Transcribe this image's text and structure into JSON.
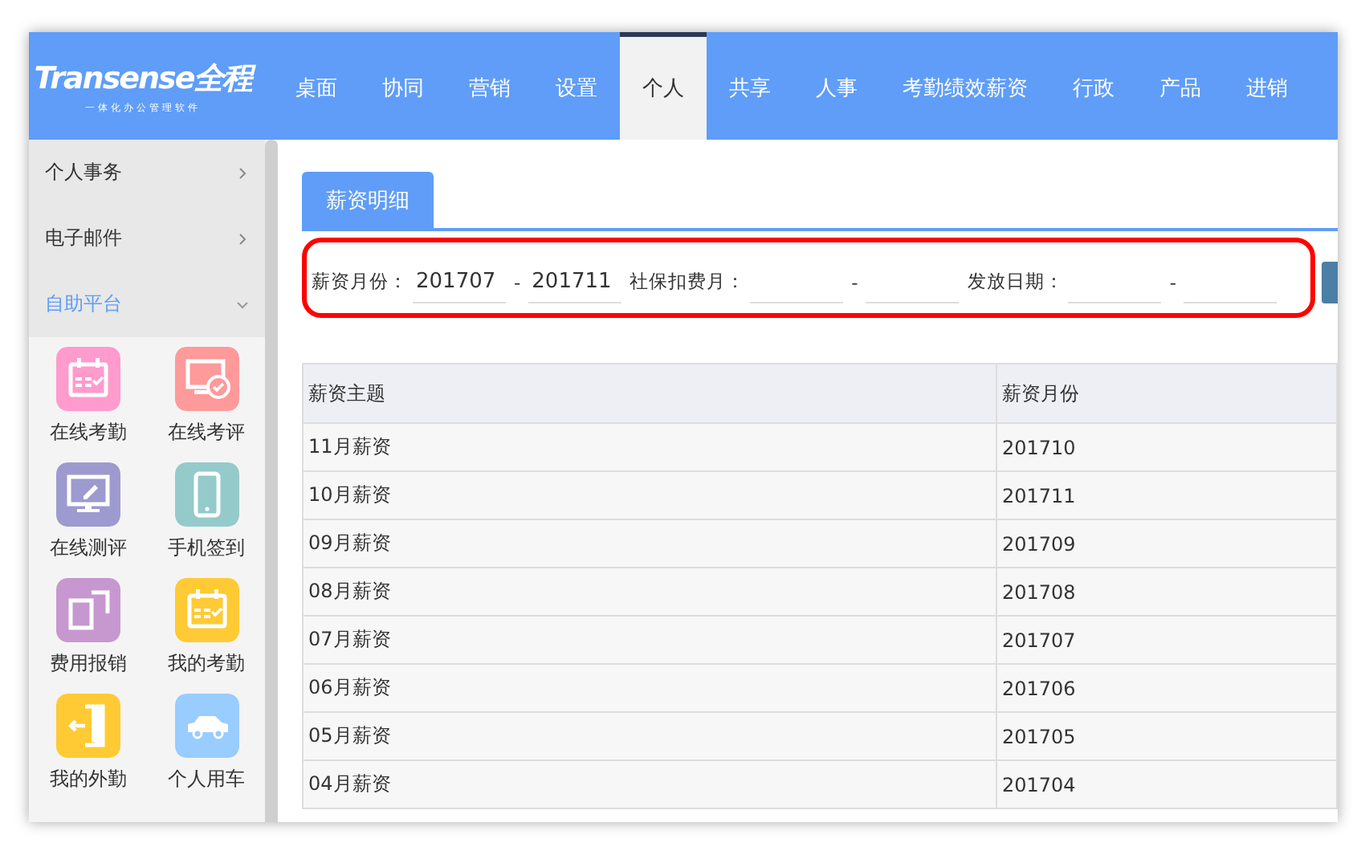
{
  "header": {
    "logo": {
      "brand": "Transense",
      "brand_cn": "全程",
      "tagline": "一体化办公管理软件"
    },
    "nav": [
      {
        "label": "桌面",
        "selected": false
      },
      {
        "label": "协同",
        "selected": false
      },
      {
        "label": "营销",
        "selected": false
      },
      {
        "label": "设置",
        "selected": false
      },
      {
        "label": "个人",
        "selected": true
      },
      {
        "label": "共享",
        "selected": false
      },
      {
        "label": "人事",
        "selected": false
      },
      {
        "label": "考勤绩效薪资",
        "selected": false
      },
      {
        "label": "行政",
        "selected": false
      },
      {
        "label": "产品",
        "selected": false
      },
      {
        "label": "进销",
        "selected": false
      }
    ]
  },
  "sidebar": {
    "items": [
      {
        "label": "个人事务",
        "expanded": false
      },
      {
        "label": "电子邮件",
        "expanded": false
      },
      {
        "label": "自助平台",
        "expanded": true
      }
    ],
    "apps": [
      {
        "label": "在线考勤",
        "kind": "calendar",
        "color": "#ff9bcd"
      },
      {
        "label": "在线考评",
        "kind": "monitor-check",
        "color": "#ff9a9a"
      },
      {
        "label": "在线测评",
        "kind": "monitor-pen",
        "color": "#9d9acf"
      },
      {
        "label": "手机签到",
        "kind": "phone",
        "color": "#94cbca"
      },
      {
        "label": "费用报销",
        "kind": "squares",
        "color": "#c698cf"
      },
      {
        "label": "我的考勤",
        "kind": "calendar",
        "color": "#ffca33"
      },
      {
        "label": "我的外勤",
        "kind": "door",
        "color": "#ffca33"
      },
      {
        "label": "个人用车",
        "kind": "car",
        "color": "#99ccff"
      }
    ]
  },
  "panel": {
    "tabs": [
      {
        "label": "薪资明细",
        "selected": true
      }
    ],
    "filters": [
      {
        "label": "薪资月份：",
        "from": "201707",
        "to": "201711"
      },
      {
        "label": "社保扣费月："
      },
      {
        "label": "发放日期："
      }
    ],
    "range_separator": "-",
    "table": {
      "columns": [
        "薪资主题",
        "薪资月份"
      ],
      "rows": [
        [
          "11月薪资",
          "201710"
        ],
        [
          "10月薪资",
          "201711"
        ],
        [
          "09月薪资",
          "201709"
        ],
        [
          "08月薪资",
          "201708"
        ],
        [
          "07月薪资",
          "201707"
        ],
        [
          "06月薪资",
          "201706"
        ],
        [
          "05月薪资",
          "201705"
        ],
        [
          "04月薪资",
          "201704"
        ]
      ]
    }
  }
}
